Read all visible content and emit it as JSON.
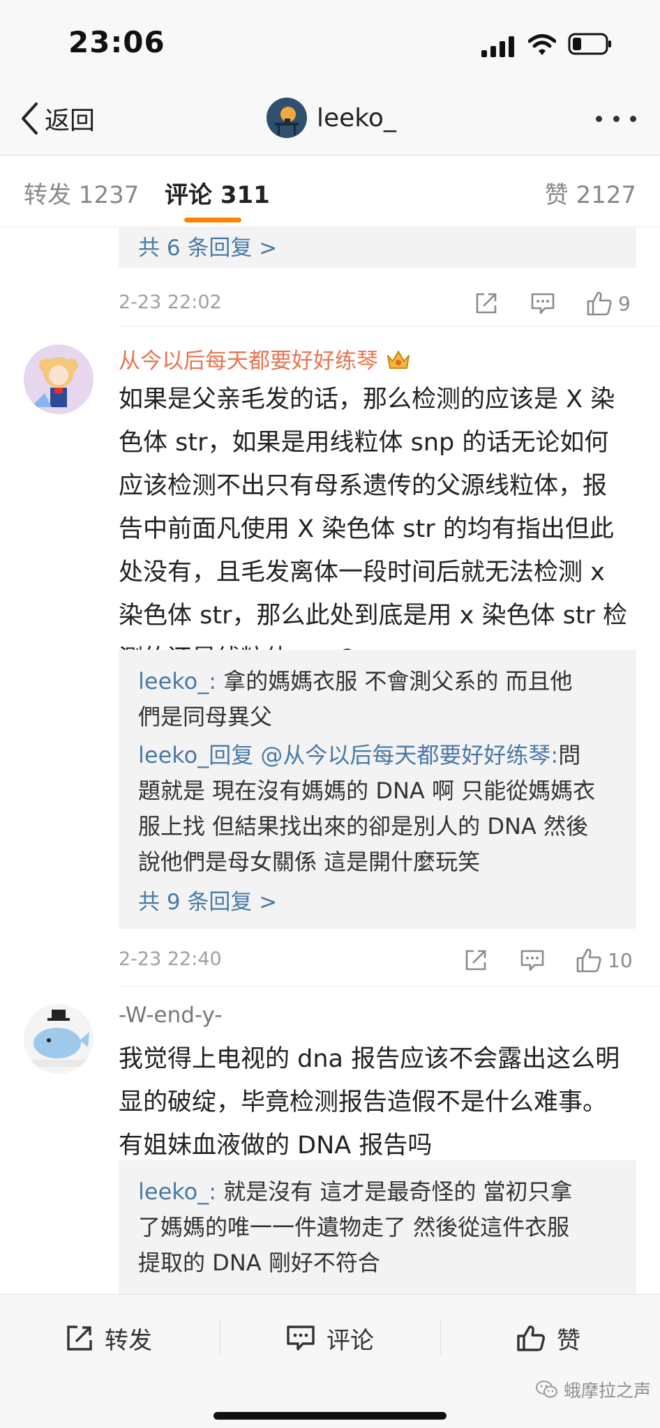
{
  "status_bar": {
    "time": "23:06"
  },
  "nav": {
    "back_label": "返回",
    "username": "leeko_"
  },
  "tabs": [
    {
      "label": "转发 1237"
    },
    {
      "label": "评论 311"
    },
    {
      "label": "赞 2127"
    }
  ],
  "active_tab": "评论 311",
  "comments": [
    {
      "reply_more": "共 6 条回复 >",
      "time": "2-23 22:02",
      "likes": "9"
    },
    {
      "author": "从今以后每天都要好好练琴",
      "badge": "crown-icon",
      "lines": [
        "如果是父亲毛发的话，那么检测的应该是 X 染",
        "色体 str，如果是用线粒体 snp 的话无论如何",
        "应该检测不出只有母系遗传的父源线粒体，报",
        "告中前面凡使用 X 染色体 str 的均有指出但此",
        "处没有，且毛发离体一段时间后就无法检测 x",
        "染色体 str，那么此处到底是用 x 染色体 str 检",
        "测的还是线粒体 snp?"
      ],
      "replies": [
        {
          "user": "leeko_:",
          "lines": [
            " 拿的媽媽衣服 不會測父系的 而且他",
            "們是同母異父"
          ]
        },
        {
          "user": "leeko_回复 @从今以后每天都要好好练琴:",
          "lines": [
            "問",
            "題就是 現在沒有媽媽的 DNA 啊 只能從媽媽衣",
            "服上找 但結果找出來的卻是別人的 DNA 然後",
            "說他們是母女關係 這是開什麼玩笑"
          ]
        }
      ],
      "reply_more": "共 9 条回复 >",
      "time": "2-23 22:40",
      "likes": "10"
    },
    {
      "author": "-W-end-y-",
      "lines": [
        "我觉得上电视的 dna 报告应该不会露出这么明",
        "显的破绽，毕竟检测报告造假不是什么难事。",
        "有姐妹血液做的 DNA 报告吗"
      ],
      "replies": [
        {
          "user": "leeko_:",
          "lines": [
            " 就是沒有 這才是最奇怪的 當初只拿",
            "了媽媽的唯一一件遺物走了 然後從這件衣服",
            "提取的 DNA 剛好不符合"
          ]
        }
      ]
    }
  ],
  "bottom_bar": {
    "repost": "转发",
    "comment": "评论",
    "like": "赞"
  },
  "watermark": "蛾摩拉之声",
  "colors": {
    "accent": "#ff8200",
    "link": "#4a79a8",
    "author": "#eb7350"
  }
}
